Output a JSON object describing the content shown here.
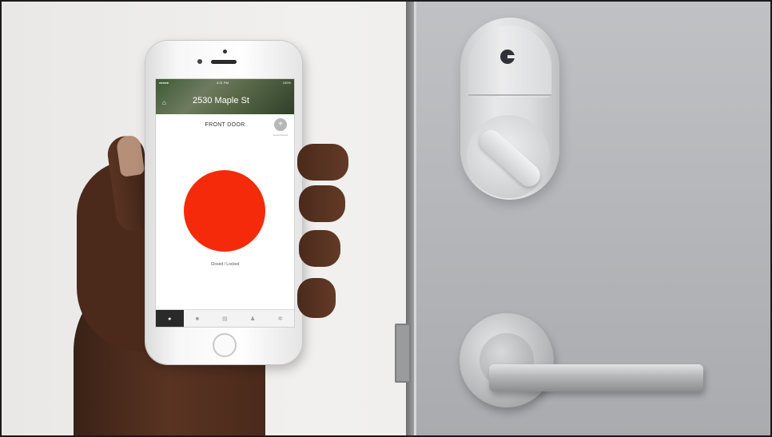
{
  "app": {
    "status_bar": {
      "carrier": "●●●●● ",
      "time": "4:21 PM",
      "battery": "100%"
    },
    "header": {
      "address": "2530 Maple St"
    },
    "door_title": "FRONT DOOR",
    "guest_button_label": "Guest Access",
    "lock_status": "Closed / Locked",
    "lock_button_color": "#f52a0a",
    "tabs": [
      {
        "icon": "lock-icon",
        "glyph": "●",
        "active": true
      },
      {
        "icon": "video-icon",
        "glyph": "■",
        "active": false
      },
      {
        "icon": "log-icon",
        "glyph": "▤",
        "active": false
      },
      {
        "icon": "user-icon",
        "glyph": "♟",
        "active": false
      },
      {
        "icon": "settings-icon",
        "glyph": "✲",
        "active": false
      }
    ]
  }
}
